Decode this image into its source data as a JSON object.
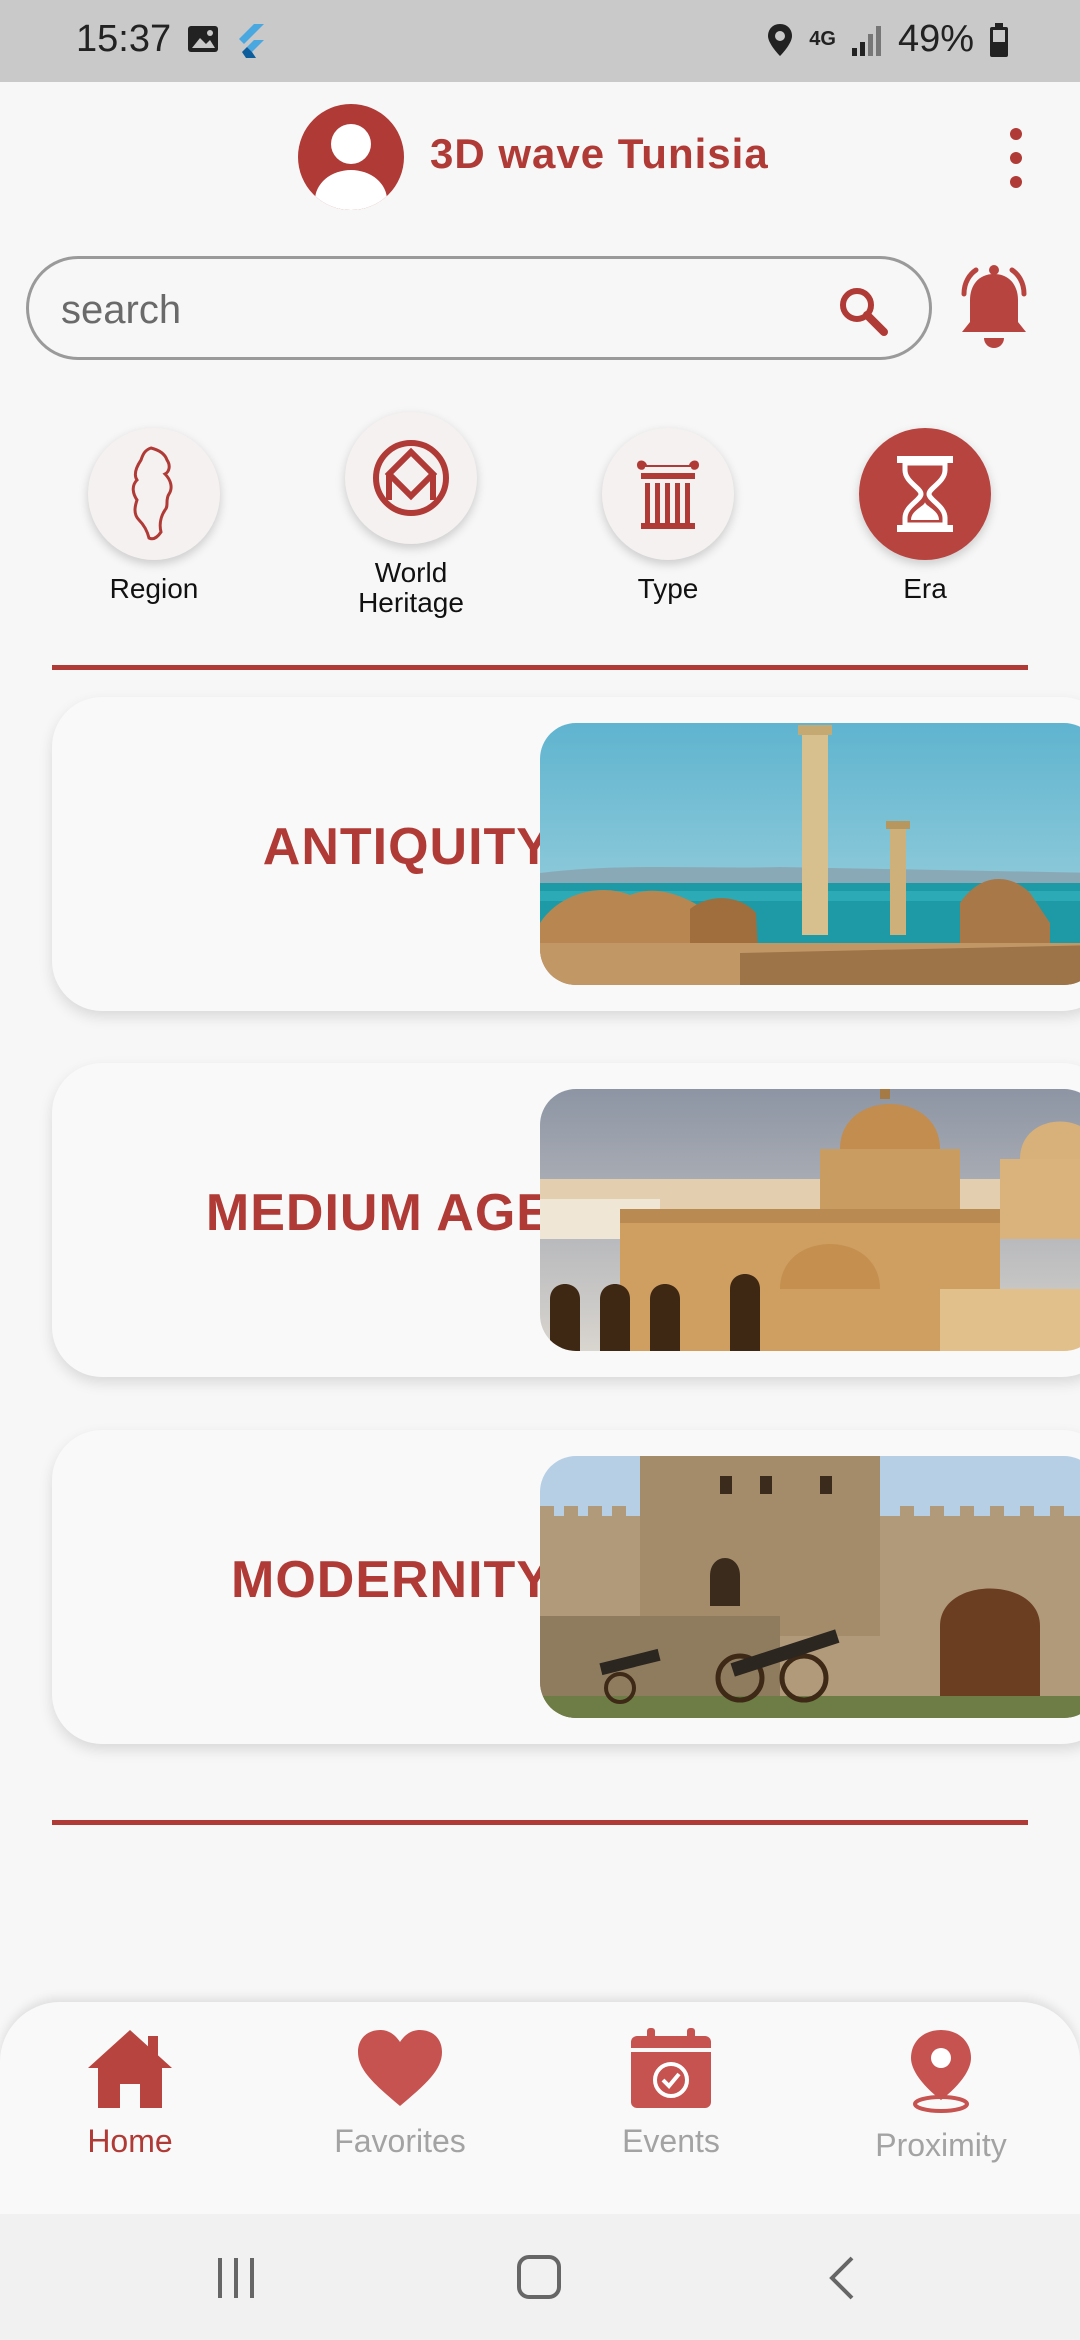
{
  "status_bar": {
    "time": "15:37",
    "network": "4G",
    "battery": "49%",
    "icons": [
      "image-icon",
      "flutter-icon",
      "location-icon",
      "signal-icon",
      "battery-icon"
    ]
  },
  "header": {
    "title": "3D wave Tunisia",
    "avatar_icon": "user-avatar-icon",
    "menu_icon": "more-vertical-icon"
  },
  "search": {
    "placeholder": "search",
    "value": ""
  },
  "filters": [
    {
      "label": "Region",
      "icon": "tunisia-map-icon",
      "active": false
    },
    {
      "label": "World Heritage",
      "icon": "world-heritage-icon",
      "active": false
    },
    {
      "label": "Type",
      "icon": "column-icon",
      "active": false
    },
    {
      "label": "Era",
      "icon": "hourglass-icon",
      "active": true
    }
  ],
  "eras": [
    {
      "title": "ANTIQUITY",
      "image": "antiquity-ruins-photo"
    },
    {
      "title": "MEDIUM AGE",
      "image": "medium-age-mosque-photo"
    },
    {
      "title": "MODERNITY",
      "image": "modernity-fortress-photo"
    }
  ],
  "bottom_nav": [
    {
      "label": "Home",
      "icon": "home-icon",
      "active": true
    },
    {
      "label": "Favorites",
      "icon": "heart-icon",
      "active": false
    },
    {
      "label": "Events",
      "icon": "calendar-check-icon",
      "active": false
    },
    {
      "label": "Proximity",
      "icon": "location-pin-icon",
      "active": false
    }
  ],
  "colors": {
    "accent": "#b03a35",
    "inactive": "#a3a3a3",
    "background": "#f7f7f7"
  }
}
